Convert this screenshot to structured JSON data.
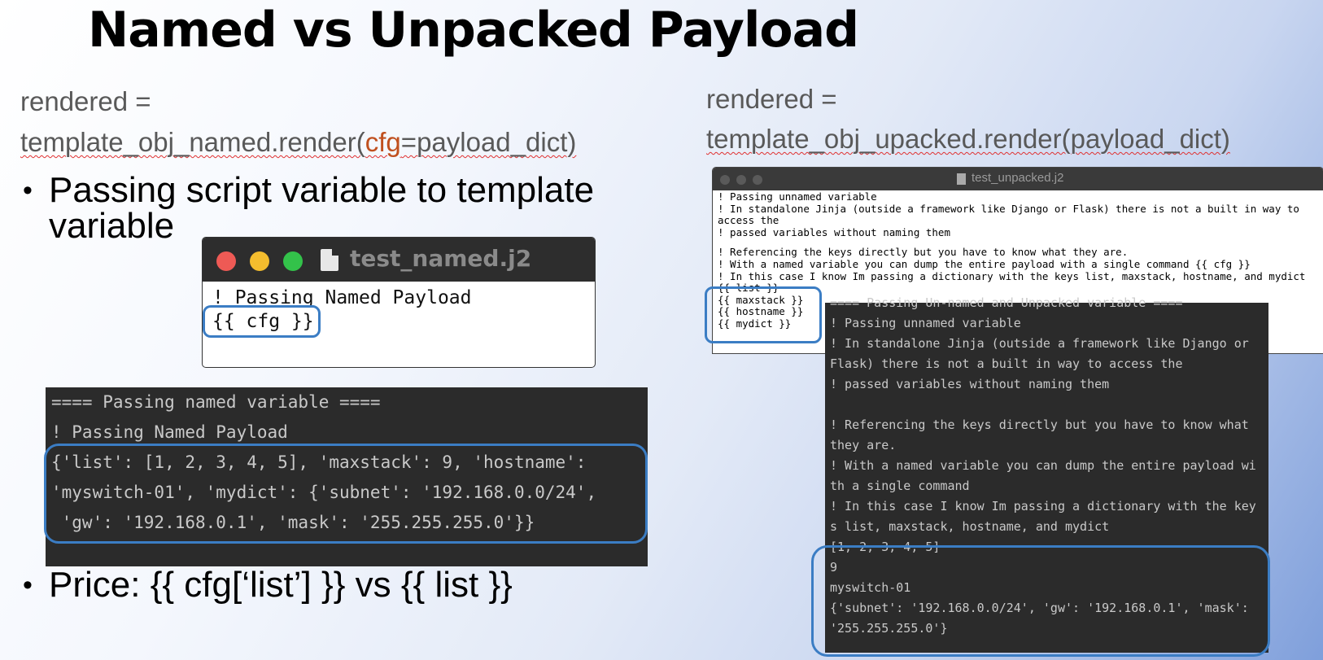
{
  "slide": {
    "title": "Named vs Unpacked Payload"
  },
  "left": {
    "code_prefix": "rendered =",
    "code_call_a": "template_obj_named.render(",
    "code_kw": "cfg",
    "code_call_b": "=payload_dict)",
    "bullet1_line1": "Passing script variable to template",
    "bullet1_line2": "variable",
    "bullet_symbol": "•",
    "bullet2": "Price: {{ cfg[‘list’] }} vs {{ list }}",
    "window": {
      "filename": "test_named.j2",
      "lines": [
        "! Passing Named Payload",
        "{{ cfg }}"
      ]
    },
    "terminal": {
      "lines": [
        "==== Passing named variable ====",
        "! Passing Named Payload",
        "{'list': [1, 2, 3, 4, 5], 'maxstack': 9, 'hostname':",
        "'myswitch-01', 'mydict': {'subnet': '192.168.0.0/24',",
        " 'gw': '192.168.0.1', 'mask': '255.255.255.0'}}"
      ]
    }
  },
  "right": {
    "code_prefix": "rendered =",
    "code_call": "template_obj_upacked.render(payload_dict)",
    "window": {
      "filename": "test_unpacked.j2",
      "lines": [
        "! Passing unnamed variable",
        "! In standalone Jinja (outside a framework like Django or Flask) there is not a built in way to",
        "access the",
        "! passed variables without naming them",
        "",
        "! Referencing the keys directly but you have to know what they are.",
        "! With a named variable you can dump the entire payload with a single command {{ cfg }}",
        "! In this case I know Im passing a dictionary with the keys list, maxstack, hostname, and mydict",
        "{{ list }}",
        "{{ maxstack }}",
        "{{ hostname }}",
        "{{ mydict }}"
      ]
    },
    "terminal": {
      "lines": [
        "==== Passing Un-named and Unpacked variable ====",
        "! Passing unnamed variable",
        "! In standalone Jinja (outside a framework like Django or",
        "Flask) there is not a built in way to access the",
        "! passed variables without naming them",
        "",
        "! Referencing the keys directly but you have to know what",
        "they are.",
        "! With a named variable you can dump the entire payload wi",
        "th a single command",
        "! In this case I know Im passing a dictionary with the key",
        "s list, maxstack, hostname, and mydict",
        "[1, 2, 3, 4, 5]",
        "9",
        "myswitch-01",
        "{'subnet': '192.168.0.0/24', 'gw': '192.168.0.1', 'mask':",
        "'255.255.255.0'}"
      ]
    }
  },
  "colors": {
    "highlight_box": "#3b7dc4",
    "keyword": "#c0501e",
    "terminal_bg": "#2b2b2b"
  }
}
